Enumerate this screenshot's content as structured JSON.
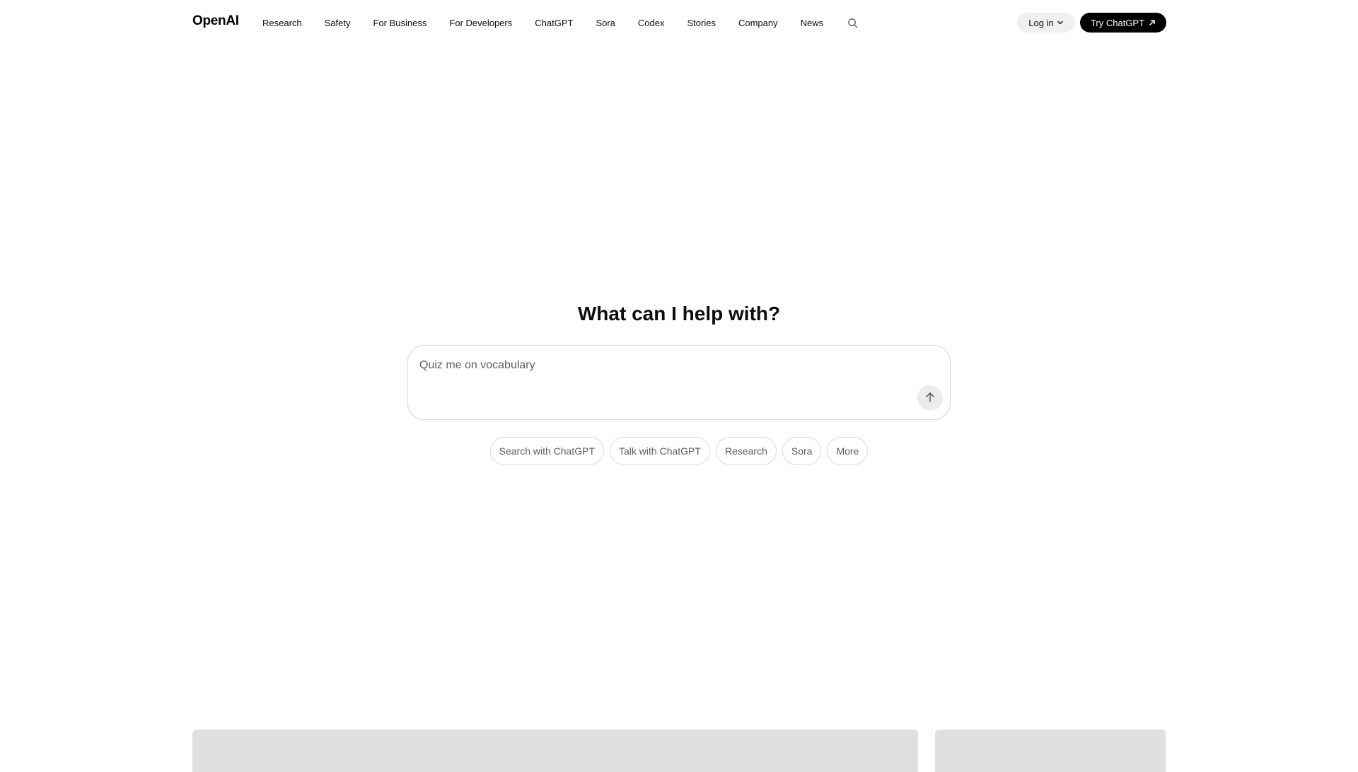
{
  "header": {
    "logo": "OpenAI",
    "nav": [
      {
        "label": "Research"
      },
      {
        "label": "Safety"
      },
      {
        "label": "For Business"
      },
      {
        "label": "For Developers"
      },
      {
        "label": "ChatGPT"
      },
      {
        "label": "Sora"
      },
      {
        "label": "Codex"
      },
      {
        "label": "Stories"
      },
      {
        "label": "Company"
      },
      {
        "label": "News"
      }
    ],
    "search_icon": "search-icon",
    "login_label": "Log in",
    "login_icon": "chevron-down-icon",
    "try_label": "Try ChatGPT",
    "try_icon": "arrow-up-right-icon"
  },
  "hero": {
    "title": "What can I help with?"
  },
  "prompt": {
    "value": "",
    "placeholder": "Quiz me on vocabulary",
    "send_icon": "arrow-up-icon"
  },
  "chips": [
    {
      "label": "Search with ChatGPT"
    },
    {
      "label": "Talk with ChatGPT"
    },
    {
      "label": "Research"
    },
    {
      "label": "Sora"
    },
    {
      "label": "More"
    }
  ],
  "colors": {
    "primary_button": "#000000",
    "secondary_button": "#f0f0f0",
    "border": "#d9d9d9",
    "muted_text": "#5d5d5d",
    "card_placeholder": "#e0e0e0"
  }
}
